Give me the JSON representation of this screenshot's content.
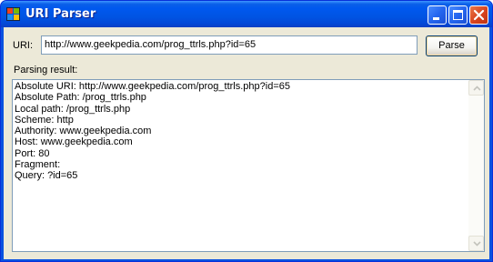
{
  "window": {
    "title": "URI Parser"
  },
  "form": {
    "uri_label": "URI:",
    "uri_value": "http://www.geekpedia.com/prog_ttrls.php?id=65",
    "parse_label": "Parse",
    "result_label": "Parsing result:"
  },
  "result": {
    "lines": [
      "Absolute URI: http://www.geekpedia.com/prog_ttrls.php?id=65",
      "Absolute Path: /prog_ttrls.php",
      "Local path: /prog_ttrls.php",
      "Scheme: http",
      "Authority: www.geekpedia.com",
      "Host: www.geekpedia.com",
      "Port: 80",
      "Fragment:",
      "Query: ?id=65"
    ]
  },
  "icons": {
    "app": "windows-logo-icon",
    "minimize": "minimize-icon",
    "maximize": "maximize-icon",
    "close": "close-icon",
    "scroll_up": "chevron-up-icon",
    "scroll_down": "chevron-down-icon"
  },
  "colors": {
    "titlebar": "#0054e3",
    "client_bg": "#ece9d8",
    "close_button": "#d8431e",
    "input_border": "#7f9db9"
  }
}
